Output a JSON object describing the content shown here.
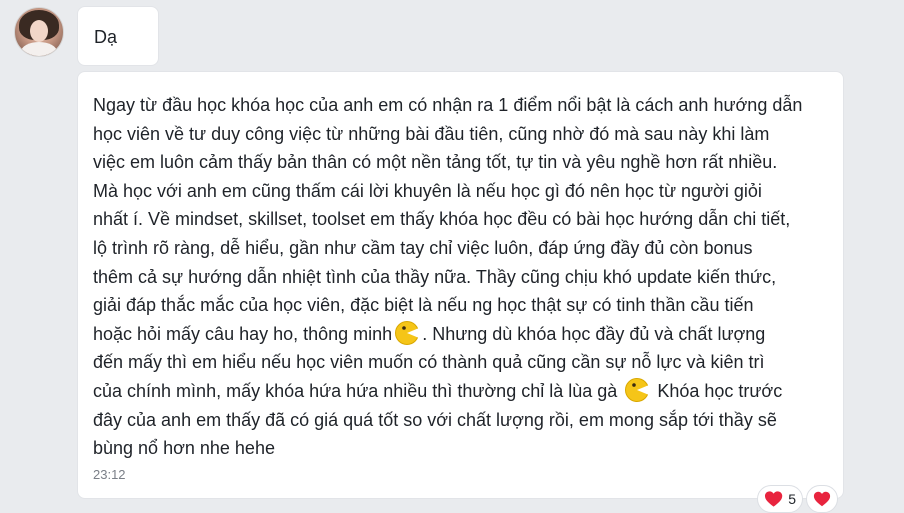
{
  "short_message": {
    "text": "Dạ"
  },
  "long_message": {
    "lines": [
      "Ngay từ đầu học khóa học của anh em có nhận ra 1 điểm nổi bật là cách anh hướng dẫn",
      "học viên về tư duy công việc từ những bài đầu tiên, cũng nhờ đó mà sau này khi làm",
      "việc em luôn cảm thấy bản thân có một nền tảng tốt, tự tin và yêu nghề hơn rất nhiều.",
      "Mà học với anh em cũng thấm cái lời khuyên là nếu học gì đó nên học từ người giỏi",
      "nhất í. Về mindset, skillset, toolset em thấy khóa học đều có bài học hướng dẫn chi tiết,",
      "lộ trình rõ ràng, dễ hiểu, gần như cầm tay chỉ việc luôn, đáp ứng đầy đủ còn bonus",
      "thêm cả sự hướng dẫn nhiệt tình của thầy nữa. Thầy cũng chịu khó update kiến thức,",
      "giải đáp thắc mắc của học viên, đặc biệt là nếu ng học thật sự có tinh thần cầu tiến"
    ],
    "line9_before": "hoặc hỏi mấy câu hay ho, thông minh",
    "line9_after": ". Nhưng dù khóa học đầy đủ và chất lượng",
    "line10": "đến mấy thì em hiểu nếu học viên muốn có thành quả cũng cần sự nỗ lực và kiên trì",
    "line11_before": "của chính mình, mấy khóa hứa hứa nhiều thì thường chỉ là lùa gà",
    "line11_after": "Khóa học trước",
    "line12": "đây của anh em thấy đã có giá quá tốt so với chất lượng rồi, em mong sắp tới thầy sẽ",
    "line13": "bùng nổ hơn nhe hehe",
    "time": "23:12"
  },
  "reactions": {
    "count": "5",
    "icon": "heart-icon",
    "color": "#e8243e"
  },
  "emoji_icon": "pacman-emoji-icon",
  "colors": {
    "background": "#e9ebee",
    "bubble": "#ffffff",
    "text": "#1f2329",
    "time": "#7a7f87",
    "emoji": "#f5c518"
  }
}
